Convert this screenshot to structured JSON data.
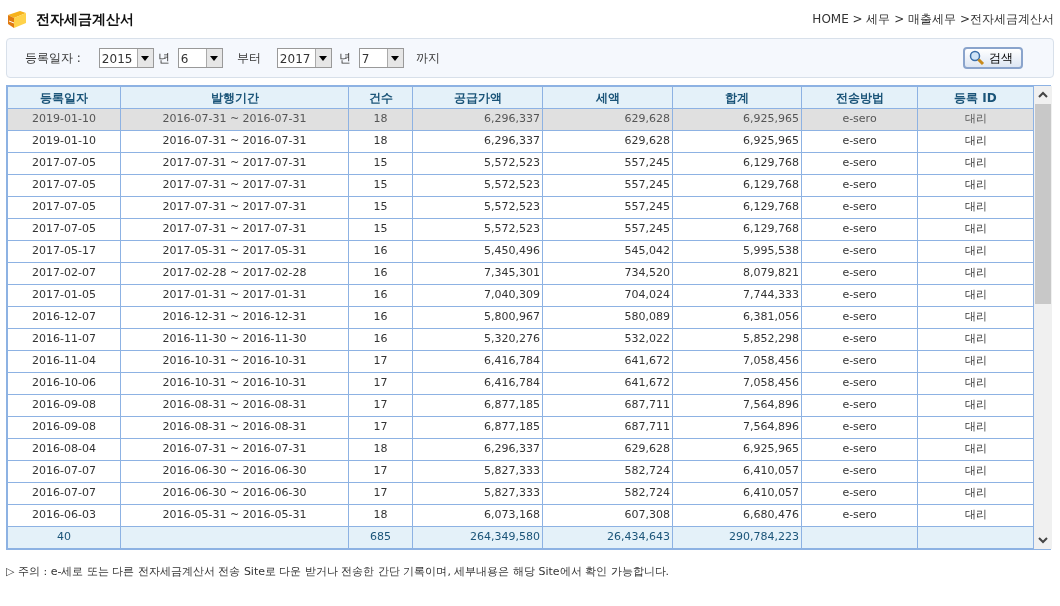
{
  "page": {
    "title": "전자세금계산서",
    "breadcrumb": "HOME > 세무 > 매출세무 >전자세금계산서"
  },
  "filter": {
    "label": "등록일자 :",
    "from_year": "2015",
    "from_year_unit": "년",
    "from_month": "6",
    "from_suffix": "부터",
    "to_year": "2017",
    "to_year_unit": "년",
    "to_month": "7",
    "to_suffix": "까지",
    "search_button": "검색"
  },
  "table": {
    "columns": [
      "등록일자",
      "발행기간",
      "건수",
      "공급가액",
      "세액",
      "합계",
      "전송방법",
      "등록 ID"
    ],
    "rows": [
      {
        "selected": true,
        "cells": [
          "2019-01-10",
          "2016-07-31 ~ 2016-07-31",
          "18",
          "6,296,337",
          "629,628",
          "6,925,965",
          "e-sero",
          "대리"
        ]
      },
      {
        "selected": false,
        "cells": [
          "2019-01-10",
          "2016-07-31 ~ 2016-07-31",
          "18",
          "6,296,337",
          "629,628",
          "6,925,965",
          "e-sero",
          "대리"
        ]
      },
      {
        "selected": false,
        "cells": [
          "2017-07-05",
          "2017-07-31 ~ 2017-07-31",
          "15",
          "5,572,523",
          "557,245",
          "6,129,768",
          "e-sero",
          "대리"
        ]
      },
      {
        "selected": false,
        "cells": [
          "2017-07-05",
          "2017-07-31 ~ 2017-07-31",
          "15",
          "5,572,523",
          "557,245",
          "6,129,768",
          "e-sero",
          "대리"
        ]
      },
      {
        "selected": false,
        "cells": [
          "2017-07-05",
          "2017-07-31 ~ 2017-07-31",
          "15",
          "5,572,523",
          "557,245",
          "6,129,768",
          "e-sero",
          "대리"
        ]
      },
      {
        "selected": false,
        "cells": [
          "2017-07-05",
          "2017-07-31 ~ 2017-07-31",
          "15",
          "5,572,523",
          "557,245",
          "6,129,768",
          "e-sero",
          "대리"
        ]
      },
      {
        "selected": false,
        "cells": [
          "2017-05-17",
          "2017-05-31 ~ 2017-05-31",
          "16",
          "5,450,496",
          "545,042",
          "5,995,538",
          "e-sero",
          "대리"
        ]
      },
      {
        "selected": false,
        "cells": [
          "2017-02-07",
          "2017-02-28 ~ 2017-02-28",
          "16",
          "7,345,301",
          "734,520",
          "8,079,821",
          "e-sero",
          "대리"
        ]
      },
      {
        "selected": false,
        "cells": [
          "2017-01-05",
          "2017-01-31 ~ 2017-01-31",
          "16",
          "7,040,309",
          "704,024",
          "7,744,333",
          "e-sero",
          "대리"
        ]
      },
      {
        "selected": false,
        "cells": [
          "2016-12-07",
          "2016-12-31 ~ 2016-12-31",
          "16",
          "5,800,967",
          "580,089",
          "6,381,056",
          "e-sero",
          "대리"
        ]
      },
      {
        "selected": false,
        "cells": [
          "2016-11-07",
          "2016-11-30 ~ 2016-11-30",
          "16",
          "5,320,276",
          "532,022",
          "5,852,298",
          "e-sero",
          "대리"
        ]
      },
      {
        "selected": false,
        "cells": [
          "2016-11-04",
          "2016-10-31 ~ 2016-10-31",
          "17",
          "6,416,784",
          "641,672",
          "7,058,456",
          "e-sero",
          "대리"
        ]
      },
      {
        "selected": false,
        "cells": [
          "2016-10-06",
          "2016-10-31 ~ 2016-10-31",
          "17",
          "6,416,784",
          "641,672",
          "7,058,456",
          "e-sero",
          "대리"
        ]
      },
      {
        "selected": false,
        "cells": [
          "2016-09-08",
          "2016-08-31 ~ 2016-08-31",
          "17",
          "6,877,185",
          "687,711",
          "7,564,896",
          "e-sero",
          "대리"
        ]
      },
      {
        "selected": false,
        "cells": [
          "2016-09-08",
          "2016-08-31 ~ 2016-08-31",
          "17",
          "6,877,185",
          "687,711",
          "7,564,896",
          "e-sero",
          "대리"
        ]
      },
      {
        "selected": false,
        "cells": [
          "2016-08-04",
          "2016-07-31 ~ 2016-07-31",
          "18",
          "6,296,337",
          "629,628",
          "6,925,965",
          "e-sero",
          "대리"
        ]
      },
      {
        "selected": false,
        "cells": [
          "2016-07-07",
          "2016-06-30 ~ 2016-06-30",
          "17",
          "5,827,333",
          "582,724",
          "6,410,057",
          "e-sero",
          "대리"
        ]
      },
      {
        "selected": false,
        "cells": [
          "2016-07-07",
          "2016-06-30 ~ 2016-06-30",
          "17",
          "5,827,333",
          "582,724",
          "6,410,057",
          "e-sero",
          "대리"
        ]
      },
      {
        "selected": false,
        "cells": [
          "2016-06-03",
          "2016-05-31 ~ 2016-05-31",
          "18",
          "6,073,168",
          "607,308",
          "6,680,476",
          "e-sero",
          "대리"
        ]
      }
    ],
    "totals": {
      "column_1": "40",
      "column_3": "685",
      "column_4": "264,349,580",
      "column_5": "26,434,643",
      "column_6": "290,784,223"
    }
  },
  "note": "▷ 주의 : e-세로 또는 다른 전자세금계산서 전송 Site로 다운 받거나 전송한 간단 기록이며, 세부내용은 해당 Site에서 확인 가능합니다."
}
